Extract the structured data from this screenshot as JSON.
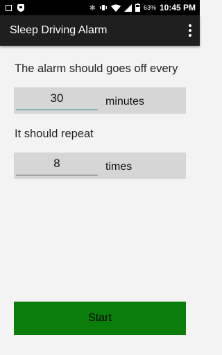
{
  "status_bar": {
    "clock": "10:45 PM",
    "battery_percent": "63%",
    "icons": [
      "square-icon",
      "shield-icon",
      "bluetooth-icon",
      "vibrate-icon",
      "wifi-icon",
      "signal-icon",
      "battery-icon"
    ]
  },
  "app_bar": {
    "title": "Sleep Driving Alarm",
    "menu_icon": "overflow-menu-icon"
  },
  "form": {
    "interval_label": "The alarm should goes off every",
    "interval_value": "30",
    "interval_unit": "minutes",
    "repeat_label": "It should repeat",
    "repeat_value": "8",
    "repeat_unit": "times"
  },
  "actions": {
    "start_label": "Start"
  },
  "colors": {
    "status_bar": "#000000",
    "app_bar": "#1f1f1f",
    "background": "#f3f3f3",
    "field_row": "#d6d6d6",
    "focused_underline": "#1a8c85",
    "start_button": "#0a7d0a"
  }
}
